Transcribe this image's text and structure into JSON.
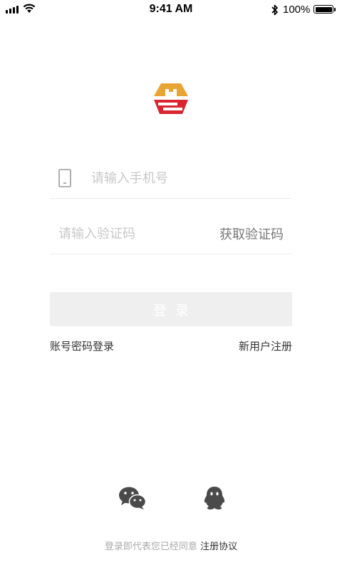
{
  "status_bar": {
    "time": "9:41 AM",
    "battery": "100%",
    "icons": [
      "signal-icon",
      "wifi-icon",
      "bluetooth-icon",
      "battery-icon"
    ]
  },
  "logo": {
    "icon": "brand-logo",
    "colors": {
      "gold": "#E8A534",
      "red": "#D9252F"
    }
  },
  "form": {
    "phone": {
      "placeholder": "请输入手机号",
      "value": "",
      "icon": "phone-icon"
    },
    "code": {
      "placeholder": "请输入验证码",
      "value": ""
    },
    "get_code_label": "获取验证码",
    "login_label": "登录"
  },
  "links": {
    "password_login": "账号密码登录",
    "register": "新用户注册"
  },
  "social": {
    "icons": [
      "wechat-icon",
      "qq-icon"
    ]
  },
  "footer": {
    "prefix": "登录即代表您已经同意",
    "agreement": "注册协议"
  }
}
